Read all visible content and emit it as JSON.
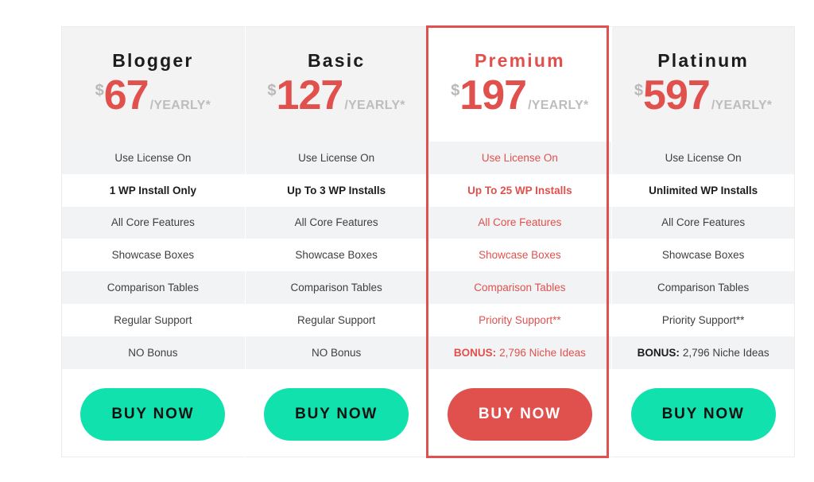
{
  "table": {
    "currency_symbol": "$",
    "period_label": "/YEARLY*",
    "accent_color": "#e0514e",
    "cta_color": "#11e1ad",
    "featured_plan": "Premium"
  },
  "plans": [
    {
      "name": "Blogger",
      "currency": "$",
      "price": "67",
      "period": "/YEARLY*",
      "features": [
        "Use License On",
        "1 WP Install Only",
        "All Core Features",
        "Showcase Boxes",
        "Comparison Tables",
        "Regular Support",
        "NO Bonus"
      ],
      "bonus_label": "",
      "bonus_rest": "",
      "cta_label": "BUY NOW"
    },
    {
      "name": "Basic",
      "currency": "$",
      "price": "127",
      "period": "/YEARLY*",
      "features": [
        "Use License On",
        "Up To 3 WP Installs",
        "All Core Features",
        "Showcase Boxes",
        "Comparison Tables",
        "Regular Support",
        "NO Bonus"
      ],
      "bonus_label": "",
      "bonus_rest": "",
      "cta_label": "BUY NOW"
    },
    {
      "name": "Premium",
      "currency": "$",
      "price": "197",
      "period": "/YEARLY*",
      "features": [
        "Use License On",
        "Up To 25 WP Installs",
        "All Core Features",
        "Showcase Boxes",
        "Comparison Tables",
        "Priority Support**",
        ""
      ],
      "bonus_label": "BONUS:",
      "bonus_rest": "2,796 Niche Ideas",
      "cta_label": "BUY NOW"
    },
    {
      "name": "Platinum",
      "currency": "$",
      "price": "597",
      "period": "/YEARLY*",
      "features": [
        "Use License On",
        "Unlimited WP Installs",
        "All Core Features",
        "Showcase Boxes",
        "Comparison Tables",
        "Priority Support**",
        ""
      ],
      "bonus_label": "BONUS:",
      "bonus_rest": "2,796 Niche Ideas",
      "cta_label": "BUY NOW"
    }
  ]
}
